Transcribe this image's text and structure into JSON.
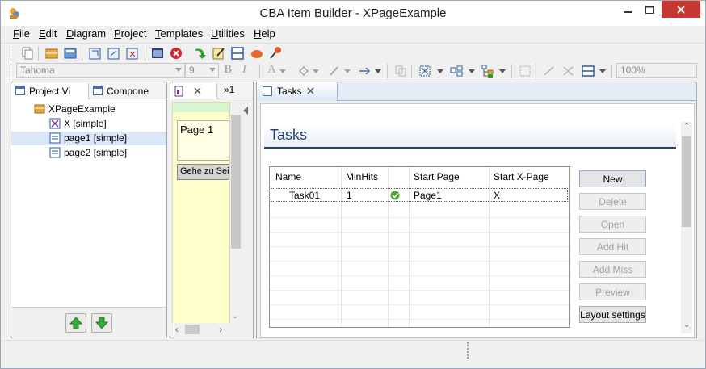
{
  "window": {
    "title": "CBA Item Builder - XPageExample"
  },
  "colors": {
    "accent": "#1f3f73",
    "selection": "#dbe6f7",
    "close_button": "#c7372f",
    "page_panel": "#ffffcc",
    "page_panel_top": "#d6f5d0",
    "check": "#4ea72e"
  },
  "menu": [
    {
      "label": "File",
      "mnemonic_index": 0
    },
    {
      "label": "Edit",
      "mnemonic_index": 0
    },
    {
      "label": "Diagram",
      "mnemonic_index": 0
    },
    {
      "label": "Project",
      "mnemonic_index": 0
    },
    {
      "label": "Templates",
      "mnemonic_index": 0
    },
    {
      "label": "Utilities",
      "mnemonic_index": 0
    },
    {
      "label": "Help",
      "mnemonic_index": 0
    }
  ],
  "toolbar": {
    "font_family": "Tahoma",
    "font_size": "9",
    "bold": "B",
    "italic": "I",
    "text_color": "A",
    "zoom": "100%"
  },
  "left_panel": {
    "tabs": [
      {
        "label": "Project Vi"
      },
      {
        "label": "Compone"
      }
    ],
    "tree": [
      {
        "label": "XPageExample",
        "icon": "project-icon",
        "level": 0,
        "selected": false
      },
      {
        "label": "X [simple]",
        "icon": "xpage-icon",
        "level": 1,
        "selected": false
      },
      {
        "label": "page1 [simple]",
        "icon": "page-icon",
        "level": 1,
        "selected": true
      },
      {
        "label": "page2 [simple]",
        "icon": "page-icon",
        "level": 1,
        "selected": false
      }
    ]
  },
  "middle_panel": {
    "tab_overflow": "»1",
    "page_label": "Page 1",
    "goto_button": "Gehe zu Seit"
  },
  "editor": {
    "tab_label": "Tasks",
    "heading": "Tasks",
    "columns": [
      "Name",
      "MinHits",
      "",
      "Start Page",
      "Start X-Page"
    ],
    "rows": [
      {
        "name": "Task01",
        "minhits": "1",
        "status": "check-icon",
        "start_page": "Page1",
        "start_xpage": "X"
      }
    ],
    "buttons": [
      {
        "label": "New",
        "enabled": true
      },
      {
        "label": "Delete",
        "enabled": false
      },
      {
        "label": "Open",
        "enabled": false
      },
      {
        "label": "Add Hit",
        "enabled": false
      },
      {
        "label": "Add Miss",
        "enabled": false
      },
      {
        "label": "Preview",
        "enabled": false
      },
      {
        "label": "Layout settings",
        "enabled": true
      }
    ]
  }
}
